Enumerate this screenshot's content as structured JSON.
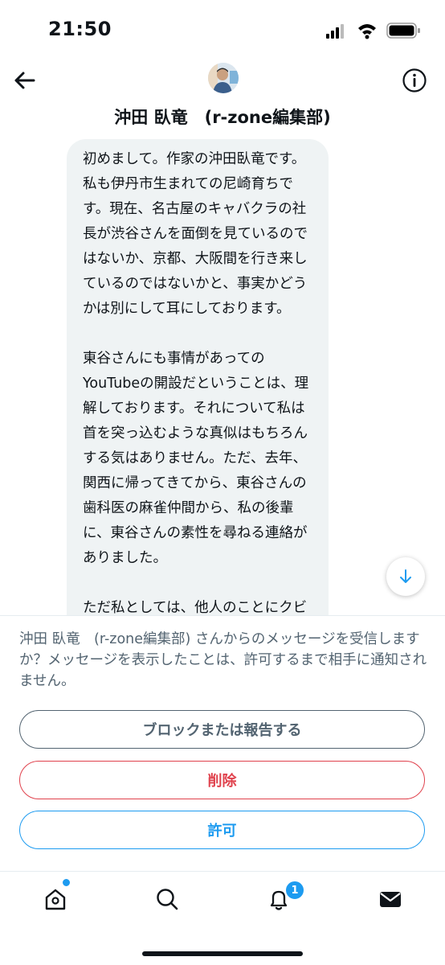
{
  "status_bar": {
    "time": "21:50"
  },
  "header": {
    "title": "沖田 臥竜　(r-zone編集部)"
  },
  "message": {
    "paragraphs": [
      "初めまして。作家の沖田臥竜です。私も伊丹市生まれての尼崎育ちです。現在、名古屋のキャバクラの社長が渋谷さんを面倒を見ているのではないか、京都、大阪間を行き来しているのではないかと、事実かどうかは別にして耳にしております。",
      "東谷さんにも事情があってのYouTubeの開設だということは、理解しております。それについて私は首を突っ込むような真似はもちろんする気はありません。ただ、去年、関西に帰ってきてから、東谷さんの歯科医の麻雀仲間から、私の後輩に、東谷さんの素性を尋ねる連絡がありました。",
      "ただ私としては、他人のことにクビを突っ込むつもりはありませんが、東谷さんが名前を上げている芸能人"
    ]
  },
  "request": {
    "text": "沖田 臥竜　(r-zone編集部) さんからのメッセージを受信しますか？メッセージを表示したことは、許可するまで相手に通知されません。",
    "block_label": "ブロックまたは報告する",
    "delete_label": "削除",
    "allow_label": "許可"
  },
  "tab_bar": {
    "items": [
      "home-icon",
      "search-icon",
      "notifications-icon",
      "messages-icon"
    ],
    "notifications_badge": "1"
  },
  "colors": {
    "accent": "#1d9bf0",
    "danger": "#e0424d",
    "muted": "#536471"
  }
}
